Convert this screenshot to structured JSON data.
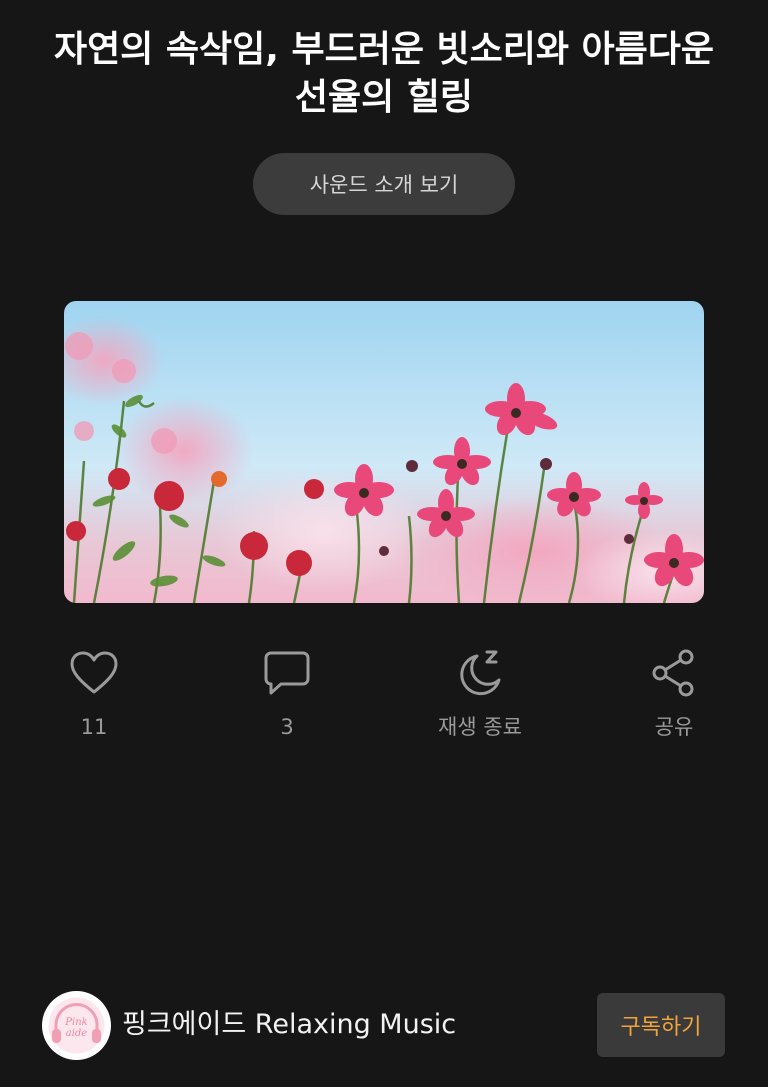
{
  "post": {
    "title": "자연의 속삭임, 부드러운 빗소리와 아름다운 선율의 힐링",
    "intro_button": "사운드 소개 보기",
    "thumbnail_alt": "분홍 코스모스 꽃밭과 하늘"
  },
  "actions": [
    {
      "icon": "heart-icon",
      "label": "11"
    },
    {
      "icon": "comment-icon",
      "label": "3"
    },
    {
      "icon": "moon-sleep-icon",
      "label": "재생 종료"
    },
    {
      "icon": "share-icon",
      "label": "공유"
    }
  ],
  "channel": {
    "avatar_text_line1": "Pink",
    "avatar_text_line2": "aide",
    "name": "핑크에이드 Relaxing Music",
    "subscribe_label": "구독하기"
  },
  "colors": {
    "background": "#161616",
    "button_bg": "#3c3c3c",
    "muted_text": "#9a9a9a",
    "subscribe_accent": "#f0a43a",
    "brand_pink": "#f0a0b4"
  }
}
